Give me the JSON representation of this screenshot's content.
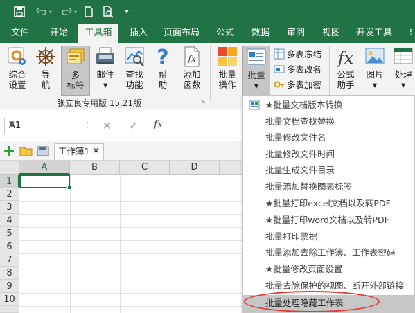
{
  "tabs": [
    "文件",
    "开始",
    "工具箱",
    "插入",
    "页面布局",
    "公式",
    "数据",
    "审阅",
    "视图",
    "开发工具"
  ],
  "active_tab": "工具箱",
  "ribbon": {
    "buttons": [
      {
        "id": "settings",
        "label": "综合\n设置",
        "icon": "settings-icon"
      },
      {
        "id": "nav",
        "label": "导\n航",
        "icon": "helm-icon"
      },
      {
        "id": "multilabel",
        "label": "多\n标签",
        "icon": "multi-tab-icon"
      },
      {
        "id": "mail",
        "label": "邮件\n▾",
        "icon": "mail-icon"
      },
      {
        "id": "find",
        "label": "查找\n功能",
        "icon": "find-icon"
      },
      {
        "id": "help",
        "label": "帮\n助",
        "icon": "help-icon"
      },
      {
        "id": "addfunc",
        "label": "添加\n函数",
        "icon": "function-file-icon"
      },
      {
        "id": "batchop",
        "label": "批量\n操作",
        "icon": "batch-op-icon"
      },
      {
        "id": "batch",
        "label": "批量\n▾",
        "icon": "batch-icon"
      },
      {
        "id": "formula",
        "label": "公式\n助手",
        "icon": "fx-icon"
      },
      {
        "id": "image",
        "label": "图片\n▾",
        "icon": "image-icon"
      },
      {
        "id": "process",
        "label": "处理\n▾",
        "icon": "process-icon"
      }
    ],
    "small_buttons": [
      {
        "label": "多表冻结",
        "icon": "freeze-icon"
      },
      {
        "label": "多表改名",
        "icon": "rename-icon"
      },
      {
        "label": "多表加密",
        "icon": "key-icon"
      }
    ],
    "group_label": "张立良专用版 15.21版"
  },
  "formula_bar": {
    "name_box": "A1",
    "cancel": "✕",
    "enter": "✓",
    "fx": "fx"
  },
  "workbook_tab": "工作簿1",
  "grid": {
    "columns": [
      "A",
      "B",
      "C",
      "D"
    ],
    "rows": [
      "1",
      "2",
      "3",
      "4",
      "5",
      "6",
      "7",
      "8",
      "9",
      "10"
    ]
  },
  "menu": {
    "items": [
      "★批量文档版本转换",
      "批量文档查找替换",
      "批量修改文件名",
      "批量修改文件时间",
      "批量生成文件目录",
      "批量添加替换图表标签",
      "★批量打印excel文档以及转PDF",
      "★批量打印word文档以及转PDF",
      "批量打印票据",
      "批量添加去除工作簿、工作表密码",
      "★批量修改页面设置",
      "批量去除保护的视图、断开外部链接",
      "批量处理隐藏工作表"
    ],
    "highlighted_index": 12
  },
  "colors": {
    "brand": "#217346",
    "ribbon_bg": "#f3f3f3",
    "highlight": "#c6c6c6",
    "annotation": "#e53935"
  }
}
